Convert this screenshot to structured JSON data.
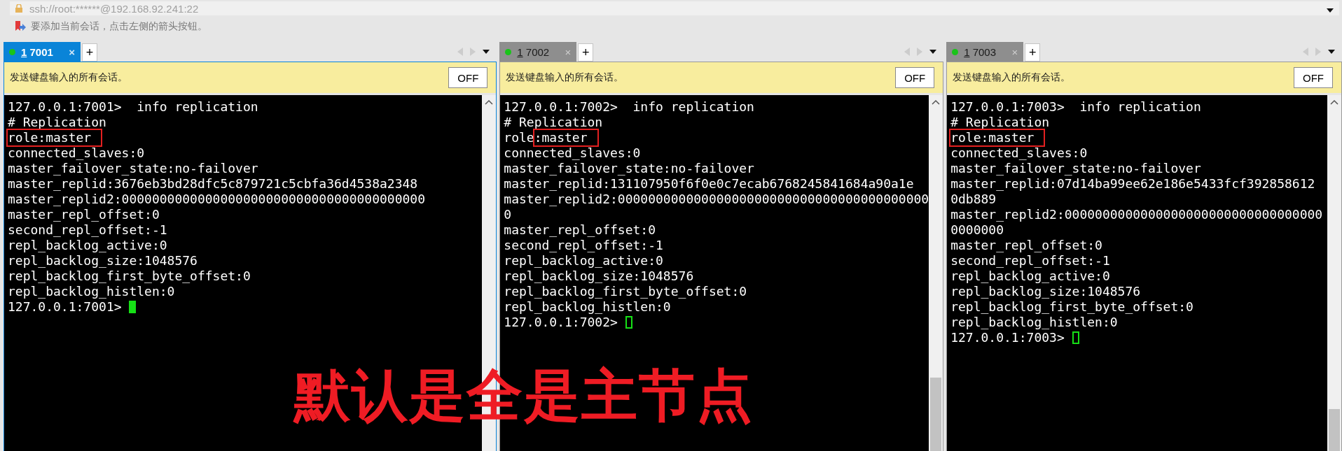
{
  "address_bar": {
    "value": "ssh://root:******@192.168.92.241:22"
  },
  "hint_bar": {
    "text": "要添加当前会话，点击左侧的箭头按钮。"
  },
  "panes": [
    {
      "tab": {
        "number": "1",
        "label": "7001",
        "selected": true,
        "connected": true
      },
      "tab_close": "×",
      "tab_add": "+",
      "broadcast_bar": {
        "text": "发送键盘输入的所有会话。",
        "button": "OFF"
      },
      "terminal": {
        "lines": [
          {
            "text": "127.0.0.1:7001>  info replication"
          },
          {
            "text": "# Replication"
          },
          {
            "segments": [
              {
                "text": "role:master",
                "boxed": true
              }
            ]
          },
          {
            "text": "connected_slaves:0"
          },
          {
            "text": "master_failover_state:no-failover"
          },
          {
            "text": "master_replid:3676eb3bd28dfc5c879721c5cbfa36d4538a2348"
          },
          {
            "text": "master_replid2:0000000000000000000000000000000000000000"
          },
          {
            "text": "master_repl_offset:0"
          },
          {
            "text": "second_repl_offset:-1"
          },
          {
            "text": "repl_backlog_active:0"
          },
          {
            "text": "repl_backlog_size:1048576"
          },
          {
            "text": "repl_backlog_first_byte_offset:0"
          },
          {
            "text": "repl_backlog_histlen:0"
          },
          {
            "text": "127.0.0.1:7001> ",
            "cursor": true
          }
        ]
      }
    },
    {
      "tab": {
        "number": "1",
        "label": "7002",
        "selected": false,
        "connected": true
      },
      "tab_close": "×",
      "tab_add": "+",
      "broadcast_bar": {
        "text": "发送键盘输入的所有会话。",
        "button": "OFF"
      },
      "terminal": {
        "lines": [
          {
            "text": "127.0.0.1:7002>  info replication"
          },
          {
            "text": "# Replication"
          },
          {
            "segments": [
              {
                "text": "role",
                "boxed": false
              },
              {
                "text": ":master",
                "boxed": true
              }
            ]
          },
          {
            "text": "connected_slaves:0"
          },
          {
            "text": "master_failover_state:no-failover"
          },
          {
            "text": "master_replid:131107950f6f0e0c7ecab6768245841684a90a1e"
          },
          {
            "text": "master_replid2:00000000000000000000000000000000000000000"
          },
          {
            "text": "0"
          },
          {
            "text": "master_repl_offset:0"
          },
          {
            "text": "second_repl_offset:-1"
          },
          {
            "text": "repl_backlog_active:0"
          },
          {
            "text": "repl_backlog_size:1048576"
          },
          {
            "text": "repl_backlog_first_byte_offset:0"
          },
          {
            "text": "repl_backlog_histlen:0"
          },
          {
            "text": "127.0.0.1:7002> ",
            "cursor": true
          }
        ]
      }
    },
    {
      "tab": {
        "number": "1",
        "label": "7003",
        "selected": false,
        "connected": true
      },
      "tab_close": "×",
      "tab_add": "+",
      "broadcast_bar": {
        "text": "发送键盘输入的所有会话。",
        "button": "OFF"
      },
      "terminal": {
        "lines": [
          {
            "text": "127.0.0.1:7003>  info replication"
          },
          {
            "text": "# Replication"
          },
          {
            "segments": [
              {
                "text": "role:master",
                "boxed": true
              }
            ]
          },
          {
            "text": "connected_slaves:0"
          },
          {
            "text": "master_failover_state:no-failover"
          },
          {
            "text": "master_replid:07d14ba99ee62e186e5433fcf392858612"
          },
          {
            "text": "0db889"
          },
          {
            "text": "master_replid2:0000000000000000000000000000000000"
          },
          {
            "text": "0000000"
          },
          {
            "text": "master_repl_offset:0"
          },
          {
            "text": "second_repl_offset:-1"
          },
          {
            "text": "repl_backlog_active:0"
          },
          {
            "text": "repl_backlog_size:1048576"
          },
          {
            "text": "repl_backlog_first_byte_offset:0"
          },
          {
            "text": "repl_backlog_histlen:0"
          },
          {
            "text": "127.0.0.1:7003> ",
            "cursor": true
          }
        ]
      }
    }
  ],
  "annotation": {
    "text": "默认是全是主节点"
  }
}
